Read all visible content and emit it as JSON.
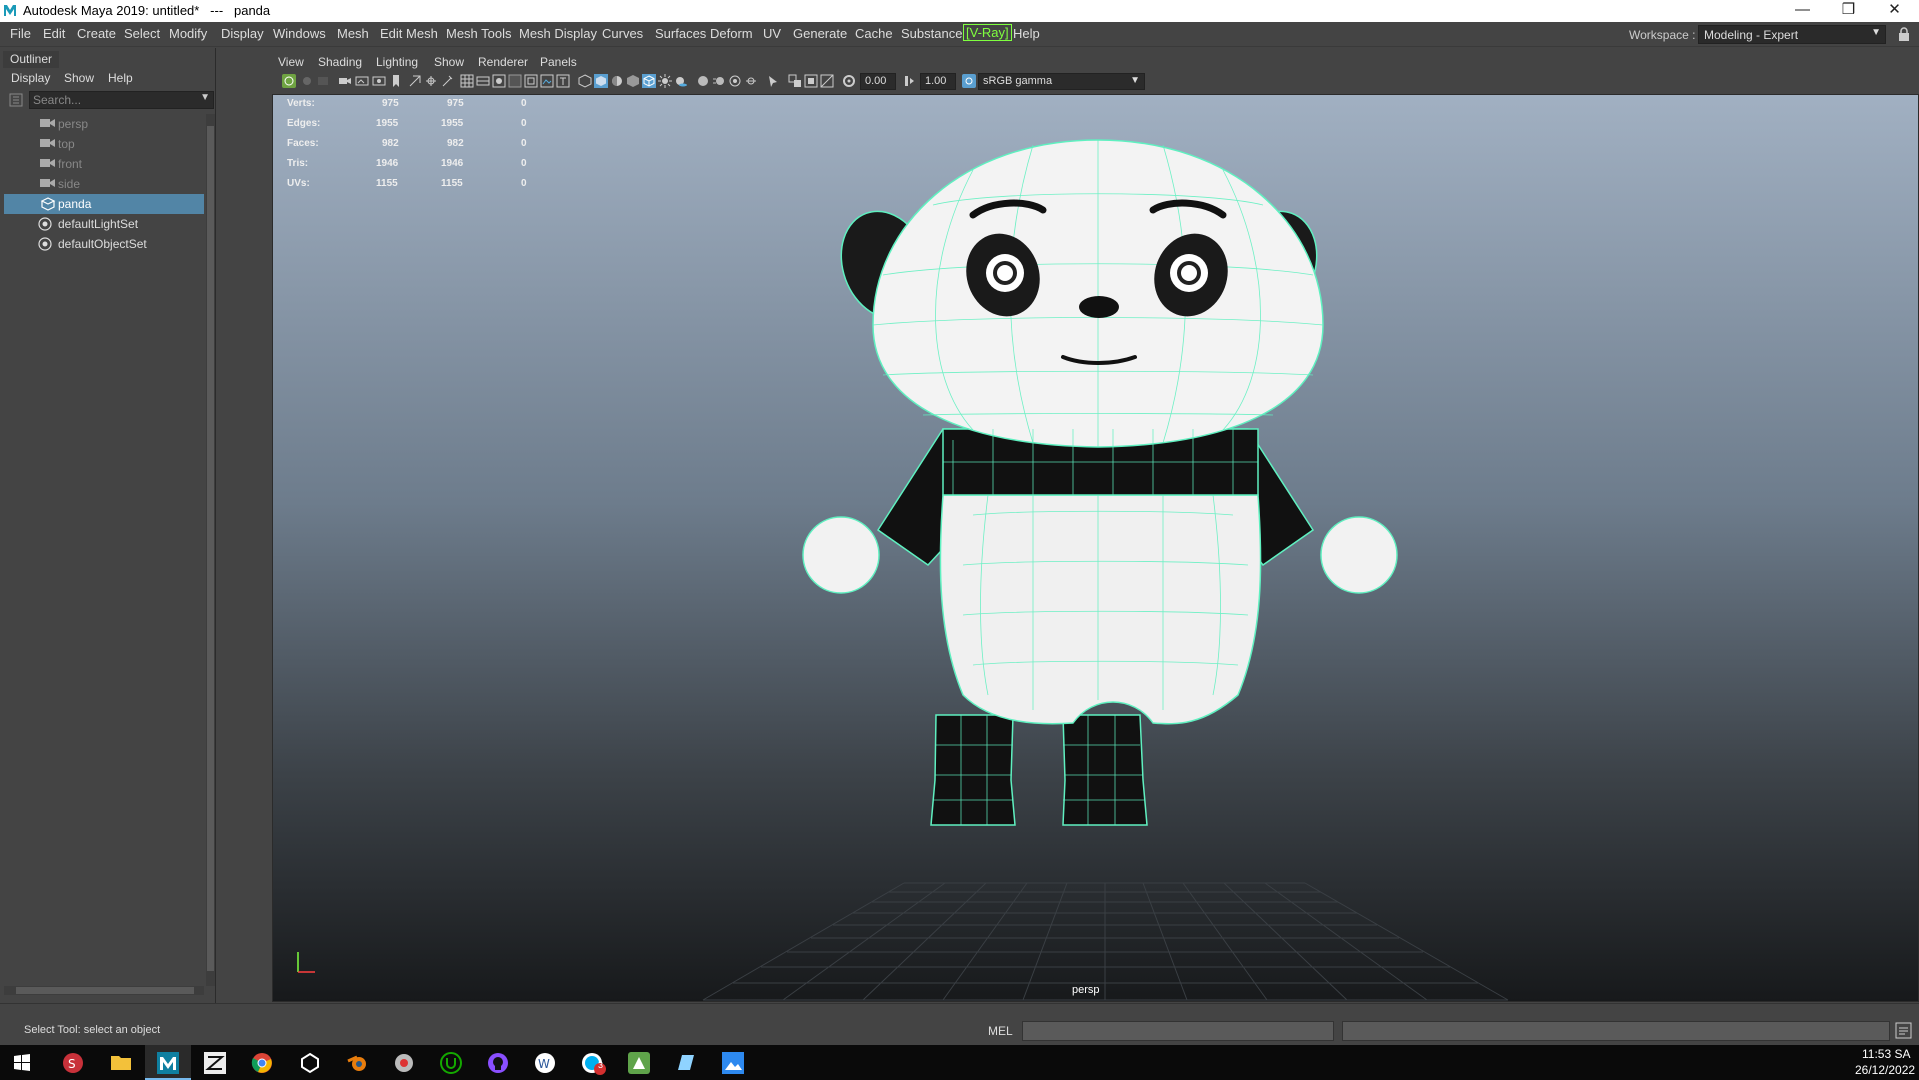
{
  "window": {
    "title": "Autodesk Maya 2019: untitled*   ---   panda",
    "controls": {
      "minimize": "—",
      "restore": "❒",
      "close": "✕"
    }
  },
  "menubar": {
    "items": [
      "File",
      "Edit",
      "Create",
      "Select",
      "Modify",
      "Display",
      "Windows",
      "Mesh",
      "Edit Mesh",
      "Mesh Tools",
      "Mesh Display",
      "Curves",
      "Surfaces",
      "Deform",
      "UV",
      "Generate",
      "Cache",
      "Substance",
      "[V-Ray]",
      "Help"
    ],
    "workspace_label": "Workspace :",
    "workspace_value": "Modeling - Expert"
  },
  "outliner": {
    "tab": "Outliner",
    "menu": [
      "Display",
      "Show",
      "Help"
    ],
    "search_placeholder": "Search...",
    "items": [
      {
        "label": "persp",
        "icon": "camera-icon",
        "dim": true
      },
      {
        "label": "top",
        "icon": "camera-icon",
        "dim": true
      },
      {
        "label": "front",
        "icon": "camera-icon",
        "dim": true
      },
      {
        "label": "side",
        "icon": "camera-icon",
        "dim": true
      },
      {
        "label": "panda",
        "icon": "mesh-transform-icon",
        "selected": true
      },
      {
        "label": "defaultLightSet",
        "icon": "set-icon"
      },
      {
        "label": "defaultObjectSet",
        "icon": "set-icon"
      }
    ]
  },
  "panel": {
    "menu": [
      "View",
      "Shading",
      "Lighting",
      "Show",
      "Renderer",
      "Panels"
    ],
    "exposure": "0.00",
    "gamma": "1.00",
    "color_space": "sRGB gamma"
  },
  "hud": {
    "rows": [
      {
        "label": "Verts:",
        "a": "975",
        "b": "975",
        "c": "0"
      },
      {
        "label": "Edges:",
        "a": "1955",
        "b": "1955",
        "c": "0"
      },
      {
        "label": "Faces:",
        "a": "982",
        "b": "982",
        "c": "0"
      },
      {
        "label": "Tris:",
        "a": "1946",
        "b": "1946",
        "c": "0"
      },
      {
        "label": "UVs:",
        "a": "1155",
        "b": "1155",
        "c": "0"
      }
    ],
    "camera": "persp"
  },
  "statusline": {
    "help": "Select Tool: select an object",
    "mel": "MEL"
  },
  "taskbar": {
    "apps": [
      "windows-start",
      "substance-painter",
      "file-explorer",
      "maya",
      "zbrush",
      "chrome",
      "unity",
      "blender",
      "marmoset",
      "upwork",
      "github",
      "word-online",
      "skype",
      "photoshop-express",
      "notes",
      "photos"
    ],
    "badge": "3",
    "time": "11:53 SA",
    "date": "26/12/2022"
  },
  "colors": {
    "wire": "#5ff0c0",
    "selection": "#5285a6",
    "vray": "#7fff3f"
  }
}
